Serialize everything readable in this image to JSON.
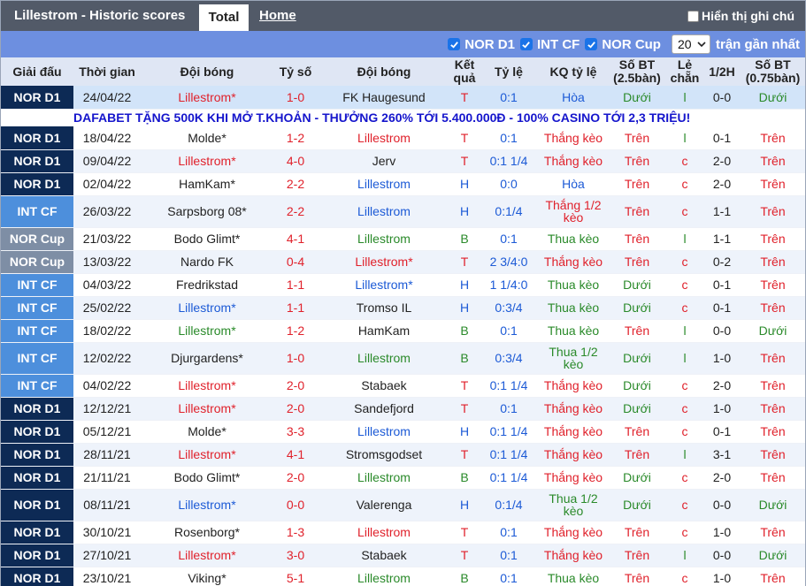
{
  "header": {
    "title": "Lillestrom - Historic scores",
    "tab_total": "Total",
    "tab_home": "Home",
    "show_note": "Hiển thị ghi chú"
  },
  "filters": {
    "items": [
      "NOR D1",
      "INT CF",
      "NOR Cup"
    ],
    "count": "20",
    "suffix": "trận gần nhất"
  },
  "columns": [
    "Giải đấu",
    "Thời gian",
    "Đội bóng",
    "Tỷ số",
    "Đội bóng",
    "Kết quả",
    "Tỷ lệ",
    "KQ tỷ lệ",
    "Số BT (2.5bàn)",
    "Lẻ chẵn",
    "1/2H",
    "Số BT (0.75bàn)"
  ],
  "ad_text": "DAFABET TẶNG 500K KHI MỞ T.KHOẢN - THƯỞNG 260% TỚI 5.400.000Đ - 100% CASINO TỚI 2,3 TRIỆU!",
  "colors": {
    "nor_d1": "#0d2a55",
    "int_cf": "#4d8fdc",
    "nor_cup": "#7e8ea5",
    "red": "#e0212b",
    "blue": "#1c5ad6",
    "green": "#2a8a2a"
  },
  "rows": [
    {
      "league": "NOR D1",
      "date": "24/04/22",
      "home": "Lillestrom*",
      "score": "1-0",
      "away": "FK Haugesund",
      "result": "T",
      "odds": "0:1",
      "odds_result": "Hòa",
      "ou25": "Dưới",
      "oe": "l",
      "half": "0-0",
      "ou075": "Dưới"
    },
    {
      "league": "NOR D1",
      "date": "18/04/22",
      "home": "Molde*",
      "score": "1-2",
      "away": "Lillestrom",
      "result": "T",
      "odds": "0:1",
      "odds_result": "Thắng kèo",
      "ou25": "Trên",
      "oe": "l",
      "half": "0-1",
      "ou075": "Trên"
    },
    {
      "league": "NOR D1",
      "date": "09/04/22",
      "home": "Lillestrom*",
      "score": "4-0",
      "away": "Jerv",
      "result": "T",
      "odds": "0:1 1/4",
      "odds_result": "Thắng kèo",
      "ou25": "Trên",
      "oe": "c",
      "half": "2-0",
      "ou075": "Trên"
    },
    {
      "league": "NOR D1",
      "date": "02/04/22",
      "home": "HamKam*",
      "score": "2-2",
      "away": "Lillestrom",
      "result": "H",
      "odds": "0:0",
      "odds_result": "Hòa",
      "ou25": "Trên",
      "oe": "c",
      "half": "2-0",
      "ou075": "Trên"
    },
    {
      "league": "INT CF",
      "date": "26/03/22",
      "home": "Sarpsborg 08*",
      "score": "2-2",
      "away": "Lillestrom",
      "result": "H",
      "odds": "0:1/4",
      "odds_result": "Thắng 1/2 kèo",
      "ou25": "Trên",
      "oe": "c",
      "half": "1-1",
      "ou075": "Trên"
    },
    {
      "league": "NOR Cup",
      "date": "21/03/22",
      "home": "Bodo Glimt*",
      "score": "4-1",
      "away": "Lillestrom",
      "result": "B",
      "odds": "0:1",
      "odds_result": "Thua kèo",
      "ou25": "Trên",
      "oe": "l",
      "half": "1-1",
      "ou075": "Trên"
    },
    {
      "league": "NOR Cup",
      "date": "13/03/22",
      "home": "Nardo FK",
      "score": "0-4",
      "away": "Lillestrom*",
      "result": "T",
      "odds": "2 3/4:0",
      "odds_result": "Thắng kèo",
      "ou25": "Trên",
      "oe": "c",
      "half": "0-2",
      "ou075": "Trên"
    },
    {
      "league": "INT CF",
      "date": "04/03/22",
      "home": "Fredrikstad",
      "score": "1-1",
      "away": "Lillestrom*",
      "result": "H",
      "odds": "1 1/4:0",
      "odds_result": "Thua kèo",
      "ou25": "Dưới",
      "oe": "c",
      "half": "0-1",
      "ou075": "Trên"
    },
    {
      "league": "INT CF",
      "date": "25/02/22",
      "home": "Lillestrom*",
      "score": "1-1",
      "away": "Tromso IL",
      "result": "H",
      "odds": "0:3/4",
      "odds_result": "Thua kèo",
      "ou25": "Dưới",
      "oe": "c",
      "half": "0-1",
      "ou075": "Trên"
    },
    {
      "league": "INT CF",
      "date": "18/02/22",
      "home": "Lillestrom*",
      "score": "1-2",
      "away": "HamKam",
      "result": "B",
      "odds": "0:1",
      "odds_result": "Thua kèo",
      "ou25": "Trên",
      "oe": "l",
      "half": "0-0",
      "ou075": "Dưới"
    },
    {
      "league": "INT CF",
      "date": "12/02/22",
      "home": "Djurgardens*",
      "score": "1-0",
      "away": "Lillestrom",
      "result": "B",
      "odds": "0:3/4",
      "odds_result": "Thua 1/2 kèo",
      "ou25": "Dưới",
      "oe": "l",
      "half": "1-0",
      "ou075": "Trên"
    },
    {
      "league": "INT CF",
      "date": "04/02/22",
      "home": "Lillestrom*",
      "score": "2-0",
      "away": "Stabaek",
      "result": "T",
      "odds": "0:1 1/4",
      "odds_result": "Thắng kèo",
      "ou25": "Dưới",
      "oe": "c",
      "half": "2-0",
      "ou075": "Trên"
    },
    {
      "league": "NOR D1",
      "date": "12/12/21",
      "home": "Lillestrom*",
      "score": "2-0",
      "away": "Sandefjord",
      "result": "T",
      "odds": "0:1",
      "odds_result": "Thắng kèo",
      "ou25": "Dưới",
      "oe": "c",
      "half": "1-0",
      "ou075": "Trên"
    },
    {
      "league": "NOR D1",
      "date": "05/12/21",
      "home": "Molde*",
      "score": "3-3",
      "away": "Lillestrom",
      "result": "H",
      "odds": "0:1 1/4",
      "odds_result": "Thắng kèo",
      "ou25": "Trên",
      "oe": "c",
      "half": "0-1",
      "ou075": "Trên"
    },
    {
      "league": "NOR D1",
      "date": "28/11/21",
      "home": "Lillestrom*",
      "score": "4-1",
      "away": "Stromsgodset",
      "result": "T",
      "odds": "0:1 1/4",
      "odds_result": "Thắng kèo",
      "ou25": "Trên",
      "oe": "l",
      "half": "3-1",
      "ou075": "Trên"
    },
    {
      "league": "NOR D1",
      "date": "21/11/21",
      "home": "Bodo Glimt*",
      "score": "2-0",
      "away": "Lillestrom",
      "result": "B",
      "odds": "0:1 1/4",
      "odds_result": "Thắng kèo",
      "ou25": "Dưới",
      "oe": "c",
      "half": "2-0",
      "ou075": "Trên"
    },
    {
      "league": "NOR D1",
      "date": "08/11/21",
      "home": "Lillestrom*",
      "score": "0-0",
      "away": "Valerenga",
      "result": "H",
      "odds": "0:1/4",
      "odds_result": "Thua 1/2 kèo",
      "ou25": "Dưới",
      "oe": "c",
      "half": "0-0",
      "ou075": "Dưới"
    },
    {
      "league": "NOR D1",
      "date": "30/10/21",
      "home": "Rosenborg*",
      "score": "1-3",
      "away": "Lillestrom",
      "result": "T",
      "odds": "0:1",
      "odds_result": "Thắng kèo",
      "ou25": "Trên",
      "oe": "c",
      "half": "1-0",
      "ou075": "Trên"
    },
    {
      "league": "NOR D1",
      "date": "27/10/21",
      "home": "Lillestrom*",
      "score": "3-0",
      "away": "Stabaek",
      "result": "T",
      "odds": "0:1",
      "odds_result": "Thắng kèo",
      "ou25": "Trên",
      "oe": "l",
      "half": "0-0",
      "ou075": "Dưới"
    },
    {
      "league": "NOR D1",
      "date": "23/10/21",
      "home": "Viking*",
      "score": "5-1",
      "away": "Lillestrom",
      "result": "B",
      "odds": "0:1",
      "odds_result": "Thua kèo",
      "ou25": "Trên",
      "oe": "c",
      "half": "1-0",
      "ou075": "Trên"
    }
  ]
}
